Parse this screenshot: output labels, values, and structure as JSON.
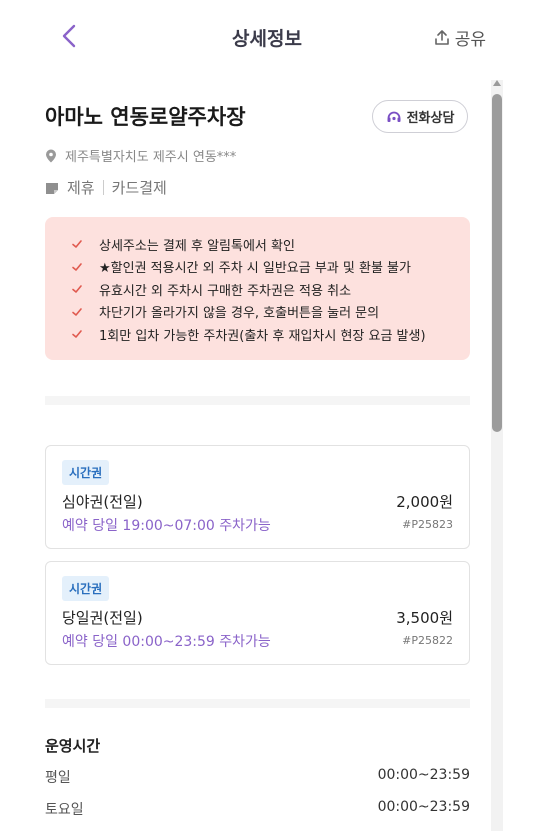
{
  "header": {
    "title": "상세정보",
    "share_label": "공유"
  },
  "lot": {
    "name": "아마노 연동로얄주차장",
    "call_button": "전화상담",
    "address": "제주특별자치도 제주시 연동***",
    "tags": [
      "제휴",
      "카드결제"
    ]
  },
  "notice": [
    "상세주소는 결제 후 알림톡에서 확인",
    "★할인권 적용시간 외 주차 시 일반요금 부과 및 환불 불가",
    "유효시간 외 주차시 구매한 주차권은 적용 취소",
    "차단기가 올라가지 않을 경우, 호출버튼을 눌러 문의",
    "1회만 입차 가능한 주차권(출차 후 재입차시 현장 요금 발생)"
  ],
  "tickets": [
    {
      "badge": "시간권",
      "name": "심야권(전일)",
      "price": "2,000원",
      "time": "예약 당일 19:00~07:00 주차가능",
      "code": "#P25823"
    },
    {
      "badge": "시간권",
      "name": "당일권(전일)",
      "price": "3,500원",
      "time": "예약 당일 00:00~23:59 주차가능",
      "code": "#P25822"
    }
  ],
  "operating": {
    "title": "운영시간",
    "rows": [
      {
        "day": "평일",
        "hours": "00:00~23:59"
      },
      {
        "day": "토요일",
        "hours": "00:00~23:59"
      }
    ]
  },
  "colors": {
    "accent": "#8a63c9",
    "notice_bg": "#fde1de",
    "check": "#e05a4f",
    "badge_bg": "#e4f0fb",
    "badge_text": "#2a6fbe"
  },
  "icons": {
    "back": "chevron-left-icon",
    "share": "share-upload-icon",
    "call": "headset-icon",
    "location": "location-pin-icon",
    "tag": "card-tag-icon",
    "check": "check-icon"
  }
}
